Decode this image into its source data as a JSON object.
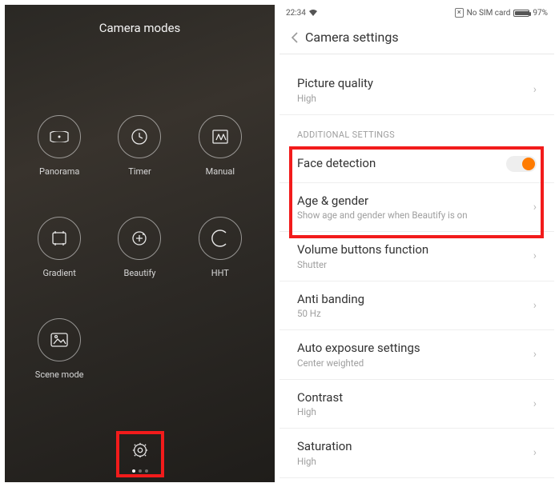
{
  "left": {
    "title": "Camera modes",
    "modes": [
      {
        "label": "Panorama",
        "icon": "panorama-icon"
      },
      {
        "label": "Timer",
        "icon": "timer-icon"
      },
      {
        "label": "Manual",
        "icon": "manual-icon"
      },
      {
        "label": "Gradient",
        "icon": "gradient-icon"
      },
      {
        "label": "Beautify",
        "icon": "beautify-icon"
      },
      {
        "label": "HHT",
        "icon": "hht-icon"
      },
      {
        "label": "Scene mode",
        "icon": "scene-icon"
      }
    ]
  },
  "right": {
    "status": {
      "time": "22:34",
      "sim": "No SIM card",
      "battery_pct": "97%"
    },
    "header": {
      "title": "Camera settings"
    },
    "rows": {
      "picture_quality": {
        "title": "Picture quality",
        "sub": "High"
      },
      "section_additional": "ADDITIONAL SETTINGS",
      "face_detection": {
        "title": "Face detection",
        "toggle": true
      },
      "age_gender": {
        "title": "Age & gender",
        "sub": "Show age and gender when Beautify is on"
      },
      "volume_buttons": {
        "title": "Volume buttons function",
        "sub": "Shutter"
      },
      "anti_banding": {
        "title": "Anti banding",
        "sub": "50 Hz"
      },
      "auto_exposure": {
        "title": "Auto exposure settings",
        "sub": "Center weighted"
      },
      "contrast": {
        "title": "Contrast",
        "sub": "High"
      },
      "saturation": {
        "title": "Saturation",
        "sub": "High"
      }
    }
  }
}
